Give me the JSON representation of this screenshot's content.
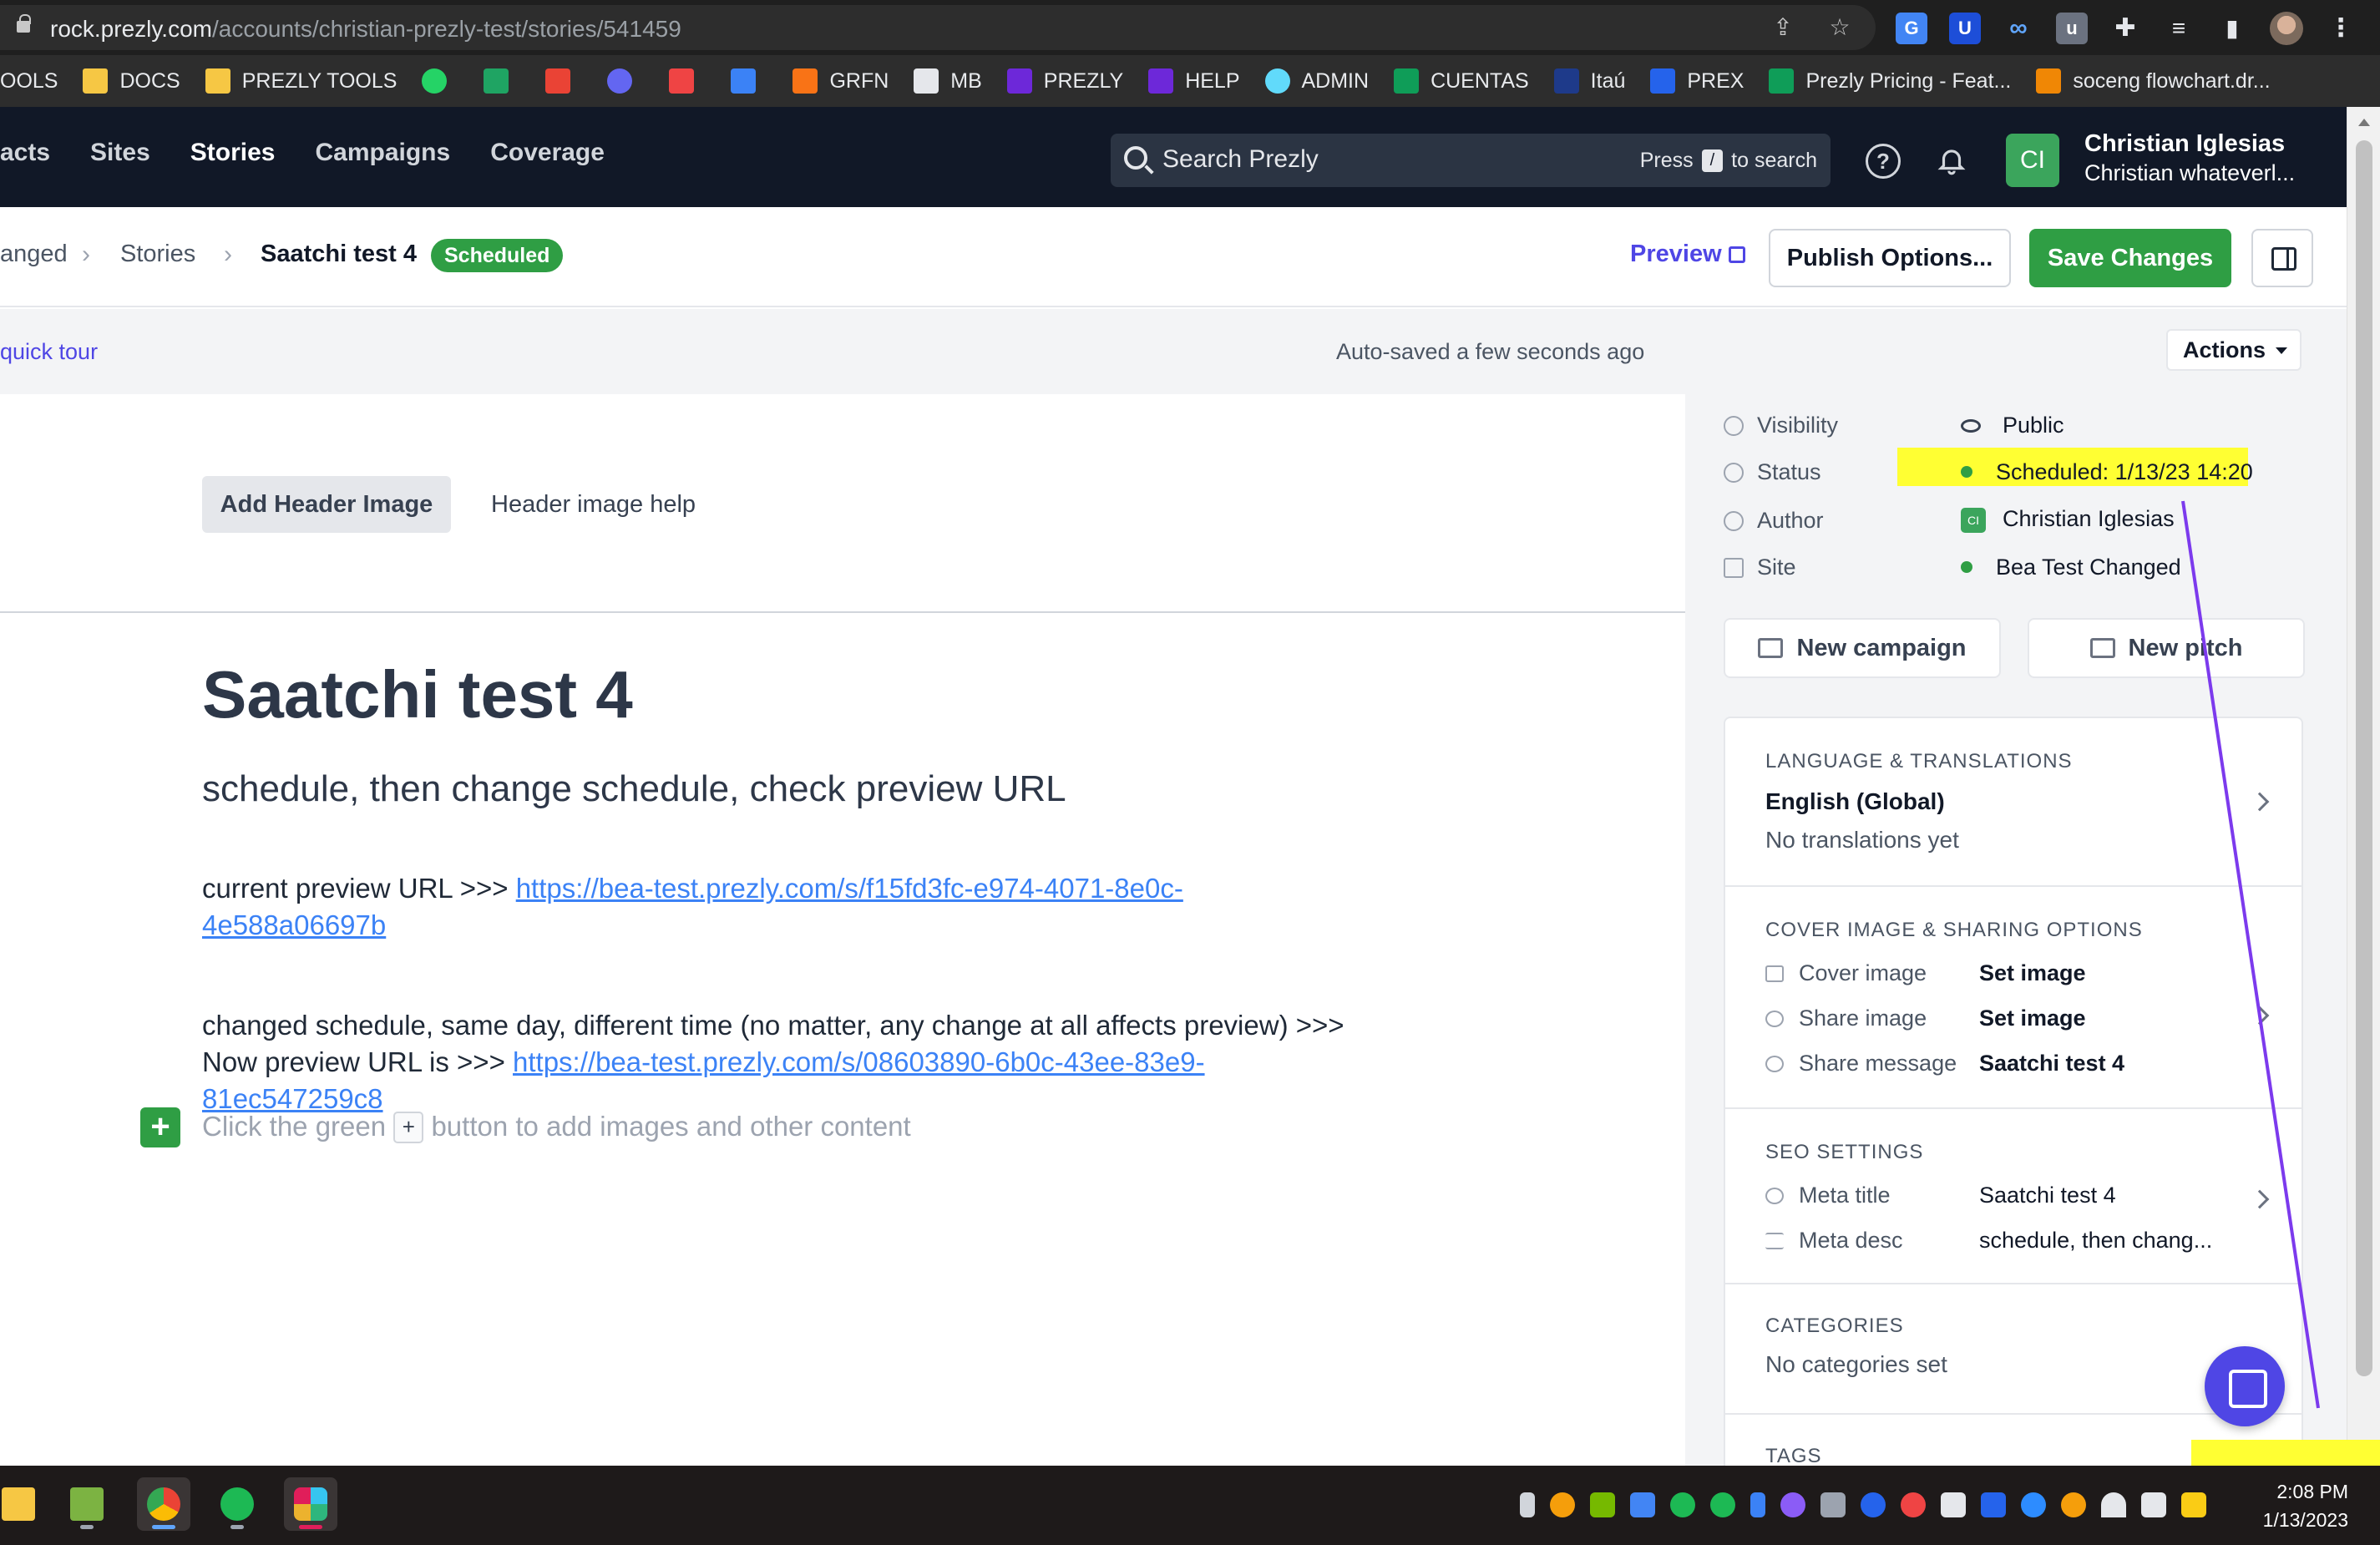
{
  "browser": {
    "url_host": "rock.prezly.com",
    "url_path": "/accounts/christian-prezly-test/stories/541459",
    "bookmarks": [
      {
        "label": "OOLS",
        "icon": "none"
      },
      {
        "label": "DOCS",
        "icon": "folder-icon"
      },
      {
        "label": "PREZLY TOOLS",
        "icon": "folder-icon"
      },
      {
        "label": "",
        "icon": "whatsapp-icon"
      },
      {
        "label": "",
        "icon": "drive-icon"
      },
      {
        "label": "",
        "icon": "gmail-icon"
      },
      {
        "label": "",
        "icon": "app-icon"
      },
      {
        "label": "",
        "icon": "party-icon"
      },
      {
        "label": "",
        "icon": "calendar-icon"
      },
      {
        "label": "GRFN",
        "icon": "grafana-icon"
      },
      {
        "label": "MB",
        "icon": "grid-icon"
      },
      {
        "label": "PREZLY",
        "icon": "prezly-icon"
      },
      {
        "label": "HELP",
        "icon": "prezly-icon"
      },
      {
        "label": "ADMIN",
        "icon": "react-icon"
      },
      {
        "label": "CUENTAS",
        "icon": "sheets-icon"
      },
      {
        "label": "Itaú",
        "icon": "itau-icon"
      },
      {
        "label": "PREX",
        "icon": "prex-icon"
      },
      {
        "label": "Prezly Pricing - Feat...",
        "icon": "sheets-icon"
      },
      {
        "label": "soceng flowchart.dr...",
        "icon": "drawio-icon"
      }
    ]
  },
  "nav": {
    "items": [
      "acts",
      "Sites",
      "Stories",
      "Campaigns",
      "Coverage"
    ],
    "active": "Stories",
    "search_placeholder": "Search Prezly",
    "search_hint_pre": "Press",
    "search_hint_key": "/",
    "search_hint_post": "to search",
    "help": "?",
    "user_initials": "CI",
    "user_name": "Christian Iglesias",
    "user_account": "Christian whateverl..."
  },
  "toolbar": {
    "crumbs": [
      "anged",
      "Stories"
    ],
    "current": "Saatchi test 4",
    "status": "Scheduled",
    "preview": "Preview",
    "publish_options": "Publish Options...",
    "save": "Save Changes"
  },
  "work": {
    "tour_link": "quick tour",
    "autosave": "Auto-saved a few seconds ago",
    "actions": "Actions"
  },
  "editor": {
    "add_header_image": "Add Header Image",
    "header_image_help": "Header image help",
    "title": "Saatchi test 4",
    "subtitle": "schedule, then change schedule, check preview URL",
    "p1_text": "current preview URL  >>> ",
    "p1_link": "https://bea-test.prezly.com/s/f15fd3fc-e974-4071-8e0c-4e588a06697b",
    "p2_text": "changed schedule, same day, different time (no matter, any change at all affects preview) >>> Now preview URL is >>> ",
    "p2_link": "https://bea-test.prezly.com/s/08603890-6b0c-43ee-83e9-81ec547259c8",
    "hint_pre": "Click the green",
    "hint_key": "+",
    "hint_post": "button to add images and other content"
  },
  "sidebar": {
    "meta": [
      {
        "label": "Visibility",
        "value": "Public"
      },
      {
        "label": "Status",
        "value": "Scheduled: 1/13/23 14:20"
      },
      {
        "label": "Author",
        "value": "Christian Iglesias"
      },
      {
        "label": "Site",
        "value": "Bea Test Changed"
      }
    ],
    "author_initials": "CI",
    "new_campaign": "New campaign",
    "new_pitch": "New pitch",
    "language_title": "LANGUAGE & TRANSLATIONS",
    "language_value": "English (Global)",
    "language_sub": "No translations yet",
    "cover_title": "COVER IMAGE & SHARING OPTIONS",
    "cover_rows": [
      {
        "label": "Cover image",
        "value": "Set image"
      },
      {
        "label": "Share image",
        "value": "Set image"
      },
      {
        "label": "Share message",
        "value": "Saatchi test 4"
      }
    ],
    "seo_title": "SEO SETTINGS",
    "seo_rows": [
      {
        "label": "Meta title",
        "value": "Saatchi test 4"
      },
      {
        "label": "Meta desc",
        "value": "schedule, then chang..."
      }
    ],
    "categories_title": "CATEGORIES",
    "categories_value": "No categories set",
    "tags_title": "TAGS"
  },
  "taskbar": {
    "time": "2:08 PM",
    "date": "1/13/2023"
  },
  "colors": {
    "brand_green": "#2f9e44",
    "link_purple": "#4f46e5",
    "nav_bg": "#111827",
    "annotation_highlight": "#ffff33",
    "annotation_line": "#7c3aed"
  }
}
